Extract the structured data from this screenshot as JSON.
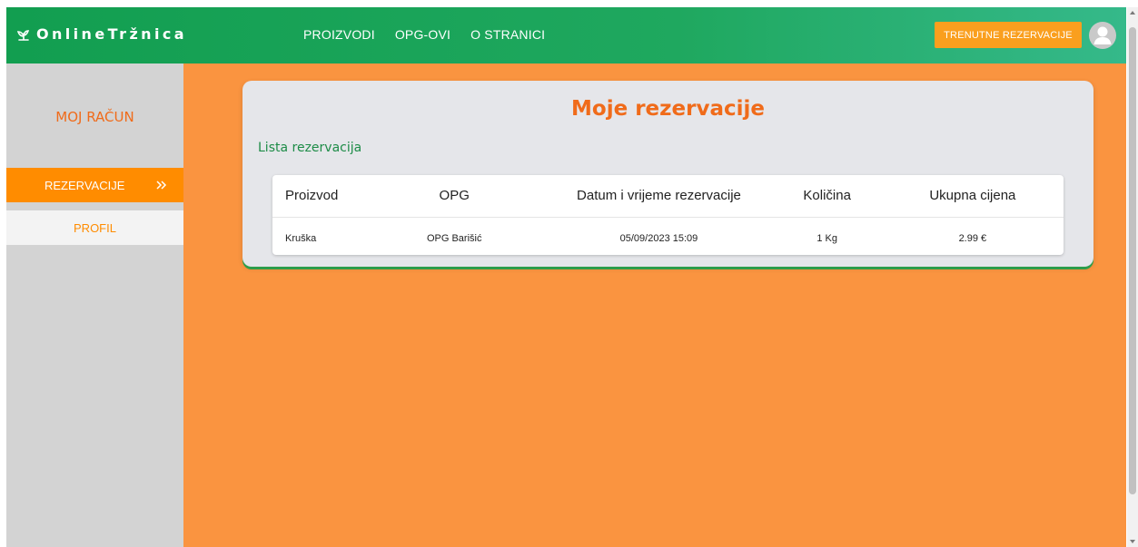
{
  "header": {
    "logo_text": "OnlineTržnica",
    "logo_icon": "leaf-sprout-icon",
    "nav": [
      "PROIZVODI",
      "OPG-OVI",
      "O STRANICI"
    ],
    "reservations_button": "TRENUTNE REZERVACIJE",
    "avatar_icon": "user-icon"
  },
  "sidebar": {
    "title": "MOJ RAČUN",
    "active_item": "REZERVACIJE",
    "active_icon": "double-chevron-right-icon",
    "item": "PROFIL"
  },
  "main": {
    "title": "Moje rezervacije",
    "subtitle": "Lista rezervacija",
    "table": {
      "headers": [
        "Proizvod",
        "OPG",
        "Datum i vrijeme rezervacije",
        "Količina",
        "Ukupna cijena"
      ],
      "rows": [
        [
          "Kruška",
          "OPG Barišić",
          "05/09/2023 15:09",
          "1 Kg",
          "2.99 €"
        ]
      ]
    }
  },
  "colors": {
    "header_green": "#1fa85f",
    "page_orange": "#fa9440",
    "accent_orange": "#ff8c00",
    "title_orange": "#f06b1a",
    "subtitle_green": "#1d8c47"
  }
}
